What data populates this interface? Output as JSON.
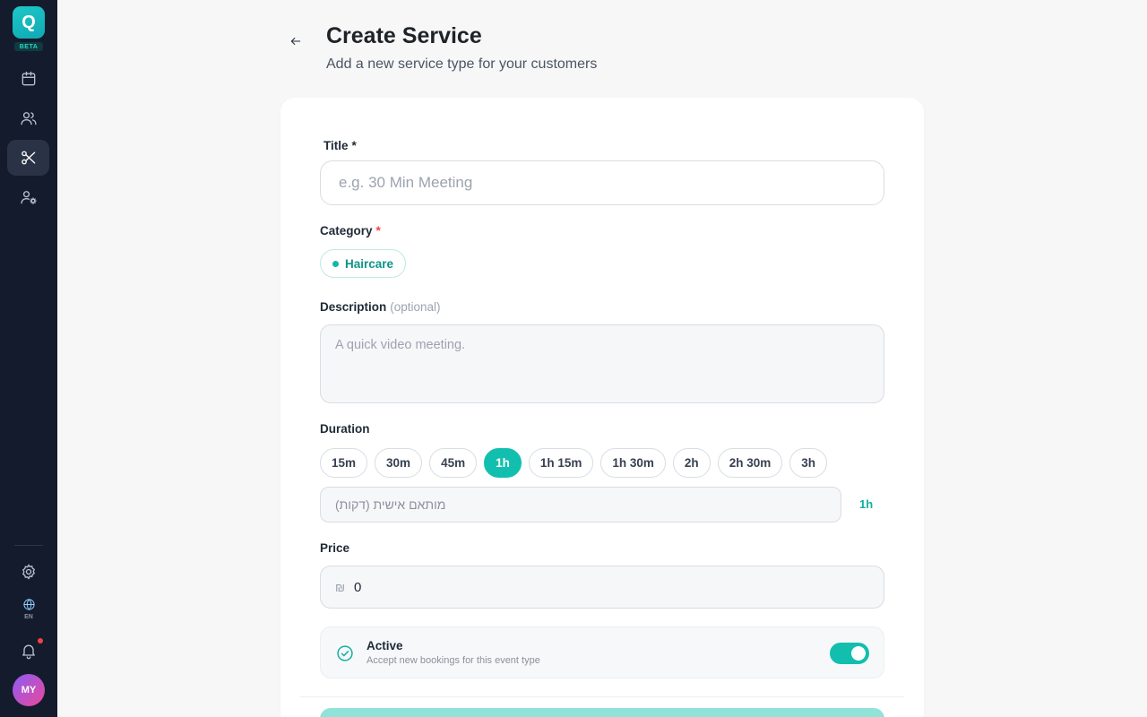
{
  "brand": {
    "logo_letter": "Q",
    "badge": "BETA"
  },
  "sidebar": {
    "items": [
      {
        "name": "calendar",
        "icon": "calendar-icon",
        "active": false
      },
      {
        "name": "customers",
        "icon": "users-icon",
        "active": false
      },
      {
        "name": "services",
        "icon": "scissors-icon",
        "active": true
      },
      {
        "name": "staff",
        "icon": "user-gear-icon",
        "active": false
      }
    ],
    "bottom": {
      "settings_icon": "gear-icon",
      "language": "EN",
      "language_icon": "globe-icon",
      "notifications_icon": "bell-icon",
      "avatar_initials": "MY"
    }
  },
  "header": {
    "back_icon": "arrow-left-icon",
    "title": "Create Service",
    "subtitle": "Add a new service type for your customers"
  },
  "form": {
    "title_label": "Title",
    "title_required_mark": "*",
    "title_placeholder": "e.g. 30 Min Meeting",
    "category_label": "Category",
    "category_required_mark": "*",
    "category_selected": "Haircare",
    "description_label": "Description",
    "description_optional": "(optional)",
    "description_placeholder": "A quick video meeting.",
    "duration_label": "Duration",
    "duration_options": [
      "15m",
      "30m",
      "45m",
      "1h",
      "1h 15m",
      "1h 30m",
      "2h",
      "2h 30m",
      "3h"
    ],
    "duration_selected": "1h",
    "custom_duration_placeholder": "מותאם אישית (דקות)",
    "duration_readout": "1h",
    "price_label": "Price",
    "price_currency": "₪",
    "price_value": "0",
    "active_title": "Active",
    "active_subtitle": "Accept new bookings for this event type",
    "active_enabled": true
  },
  "colors": {
    "accent": "#12bfae",
    "sidebar_bg": "#141b2d",
    "required": "#ef4444"
  }
}
